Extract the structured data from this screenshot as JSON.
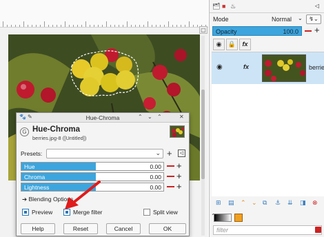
{
  "dialog": {
    "title": "Hue-Chroma",
    "heading": "Hue-Chroma",
    "subtitle": "berries.jpg-8 ([Untitled])",
    "presets_label": "Presets:",
    "presets_value": "",
    "sliders": [
      {
        "label": "Hue",
        "value": "0.00"
      },
      {
        "label": "Chroma",
        "value": "0.00"
      },
      {
        "label": "Lightness",
        "value": "0.00"
      }
    ],
    "blending_options": "Blending Options",
    "preview": {
      "label": "Preview",
      "checked": true
    },
    "merge_filter": {
      "label": "Merge filter",
      "checked": true
    },
    "split_view": {
      "label": "Split view",
      "checked": false
    },
    "buttons": {
      "help": "Help",
      "reset": "Reset",
      "cancel": "Cancel",
      "ok": "OK"
    }
  },
  "layers_panel": {
    "mode_label": "Mode",
    "mode_value": "Normal",
    "opacity_label": "Opacity",
    "opacity_value": "100.0",
    "layer": {
      "name": "berrie",
      "visible": true,
      "has_fx": true
    },
    "filter_placeholder": "filter"
  },
  "colors": {
    "accent": "#3da5dd",
    "remove": "#cc2222",
    "selection": "#cde4f7"
  }
}
